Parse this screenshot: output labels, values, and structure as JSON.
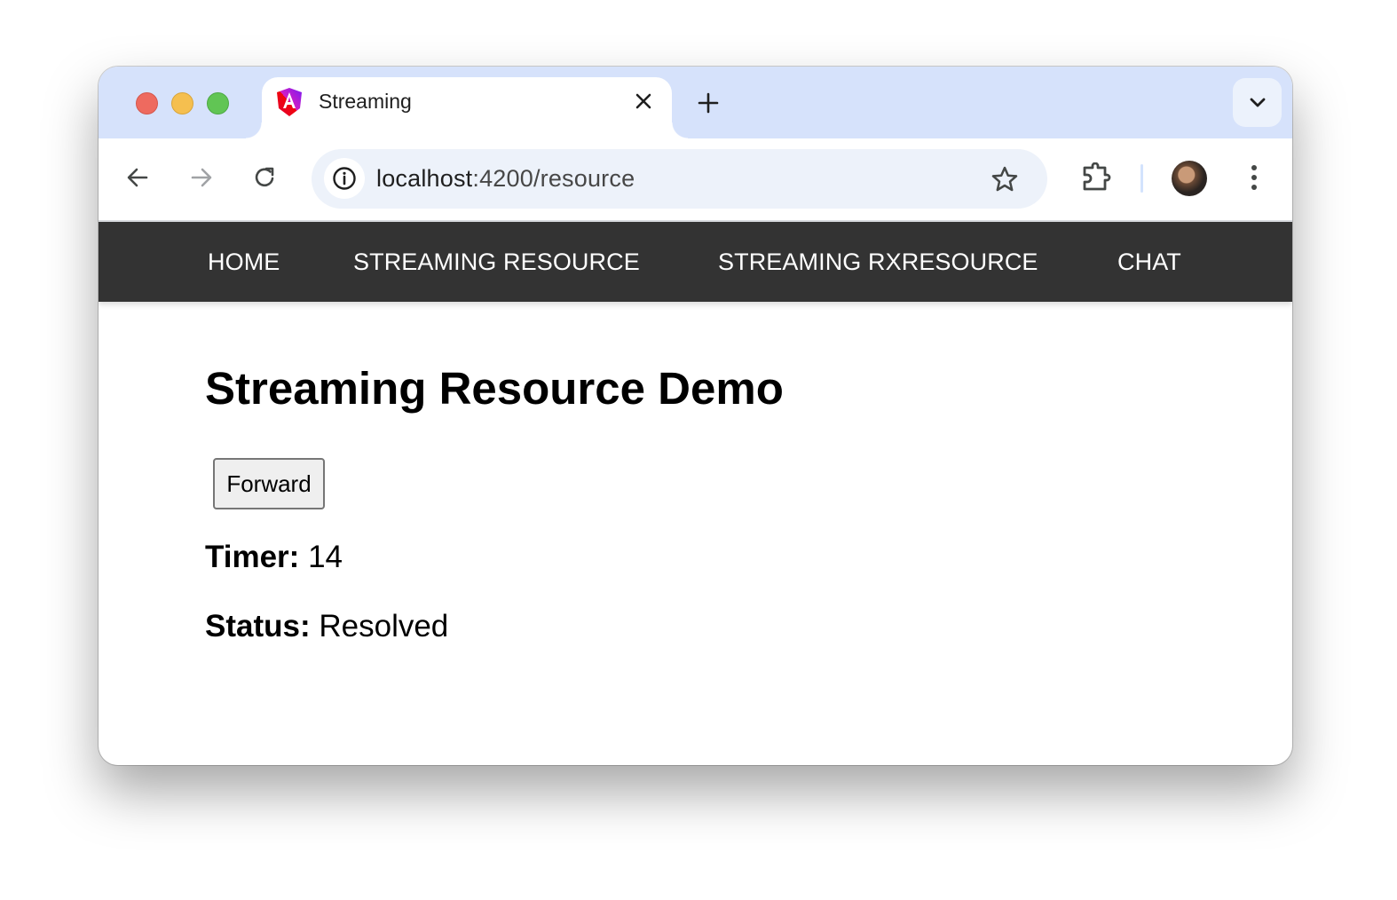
{
  "browser": {
    "tab": {
      "title": "Streaming",
      "favicon": "angular-logo-icon",
      "close_icon": "close-icon"
    },
    "new_tab_icon": "plus-icon",
    "tab_search_icon": "chevron-down-icon",
    "toolbar": {
      "back_icon": "arrow-left-icon",
      "forward_icon": "arrow-right-icon",
      "reload_icon": "reload-icon",
      "site_info_icon": "info-icon",
      "url_host": "localhost",
      "url_path": ":4200/resource",
      "bookmark_icon": "star-icon",
      "extensions_icon": "puzzle-icon",
      "profile_icon": "avatar",
      "menu_icon": "more-vertical-icon"
    },
    "colors": {
      "tabstrip_bg": "#d6e2fb",
      "omnibox_bg": "#edf2fa",
      "navbar_bg": "#333333"
    }
  },
  "nav": {
    "items": [
      {
        "label": "HOME"
      },
      {
        "label": "STREAMING RESOURCE"
      },
      {
        "label": "STREAMING RXRESOURCE"
      },
      {
        "label": "CHAT"
      }
    ]
  },
  "page": {
    "title": "Streaming Resource Demo",
    "forward_button": "Forward",
    "timer": {
      "label": "Timer:",
      "value": "14"
    },
    "status": {
      "label": "Status:",
      "value": "Resolved"
    }
  }
}
